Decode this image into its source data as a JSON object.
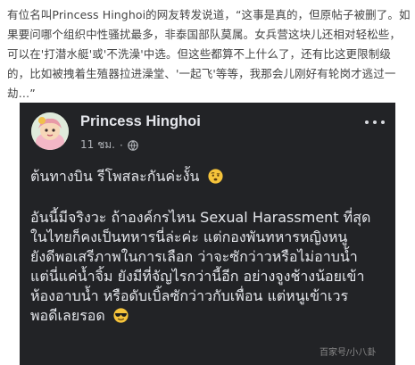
{
  "article": {
    "text": "有位名叫Princess Hinghoi的网友转发说道，“这事是真的，但原帖子被删了。如果要问哪个组织中性骚扰最多，非泰国部队莫属。女兵营这块儿还相对轻松些，可以在'打潜水艇'或'不洗澡'中选。但这些都算不上什么了，还有比这更限制级的，比如被拽着生殖器拉进澡堂、'一起飞'等等，我那会儿刚好有轮岗才逃过一劫…”"
  },
  "post": {
    "author": "Princess Hinghoi",
    "time": "11 ชม.",
    "separator": "·",
    "paragraph1": "ต้นทางบิน รีโพสละกันค่ะงั้น",
    "paragraph2_lines": [
      "อันนี้มีจริงวะ ถ้าองค์กรไหน Sexual Harassment ที่สุด",
      "ในไทยก็คงเป็นทหารนี่ล่ะค่ะ แต่กองพันทหารหญิงหนู",
      "ยังดีพอเสรีภาพในการเลือก ว่าจะซักว่าวหรือไม่อาบน้ำ",
      "แต่นี่แค่น้ำจิ้ม ยังมีที่จัญไรกว่านี้อีก อย่างจูงช้างน้อยเข้า",
      "ห้องอาบน้ำ หรือดับเบิ้ลซักว่าวกับเพื่อน แต่หนูเข้าเวร",
      "พอดีเลยรอด"
    ]
  },
  "icons": {
    "globe": "globe-icon",
    "more": "more-options-icon",
    "emoji1": "face-with-raised-eyebrow-emoji",
    "emoji2": "smiling-face-with-sunglasses-emoji"
  },
  "colors": {
    "card_background": "#222326",
    "post_text": "#e4e6eb",
    "meta_text": "#b0b3b8",
    "article_text": "#444444"
  },
  "watermark": "百家号/小八卦"
}
